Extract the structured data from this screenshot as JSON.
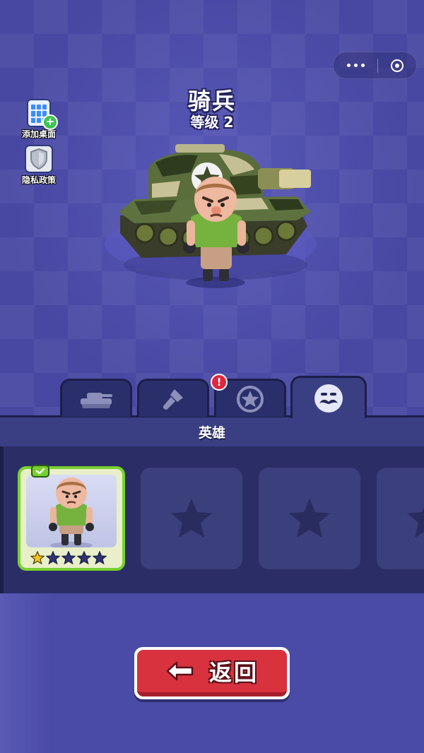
{
  "hero": {
    "name": "骑兵",
    "level_text": "等级 2"
  },
  "side_buttons": {
    "add_desktop": "添加桌面",
    "privacy": "隐私政策"
  },
  "tabs": [
    {
      "icon": "tank-icon",
      "active": false
    },
    {
      "icon": "paint-brush-icon",
      "active": false
    },
    {
      "icon": "star-emblem-icon",
      "active": false,
      "alert": "!"
    },
    {
      "icon": "mustache-face-icon",
      "active": true
    }
  ],
  "section": {
    "title": "英雄"
  },
  "cards": [
    {
      "state": "selected",
      "stars_filled": 1,
      "stars_total": 5
    },
    {
      "state": "locked",
      "icon": "star-icon"
    },
    {
      "state": "locked",
      "icon": "star-icon"
    },
    {
      "state": "locked",
      "icon": "star-icon"
    }
  ],
  "back_button": {
    "label": "返回",
    "icon": "left-arrow-icon"
  },
  "colors": {
    "accent_red": "#d7323e",
    "selected_green": "#78d12f",
    "star_gold": "#f5c518",
    "panel_dark": "#2b2e66"
  }
}
